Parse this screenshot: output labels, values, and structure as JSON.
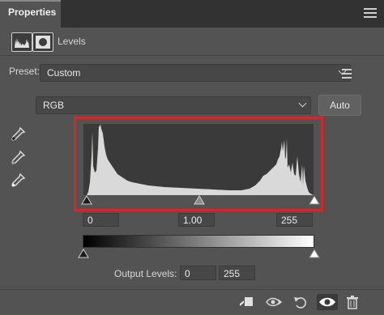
{
  "tab": {
    "title": "Properties"
  },
  "header": {
    "title": "Levels",
    "icon1": "histogram-icon",
    "icon2": "mask-icon"
  },
  "preset": {
    "label": "Preset:",
    "value": "Custom"
  },
  "channel": {
    "value": "RGB"
  },
  "auto_button": {
    "label": "Auto"
  },
  "eyedroppers": [
    "black-point-eyedropper-icon",
    "gray-point-eyedropper-icon",
    "white-point-eyedropper-icon"
  ],
  "histogram": {
    "highlight_color": "#d0292b"
  },
  "input_levels": {
    "black": "0",
    "midtone": "1.00",
    "white": "255"
  },
  "output_levels": {
    "label": "Output Levels:",
    "black": "0",
    "white": "255"
  },
  "footer_icons": [
    "clip-to-layer-icon",
    "view-previous-state-icon",
    "reset-icon",
    "visibility-eye-icon",
    "trash-icon"
  ]
}
